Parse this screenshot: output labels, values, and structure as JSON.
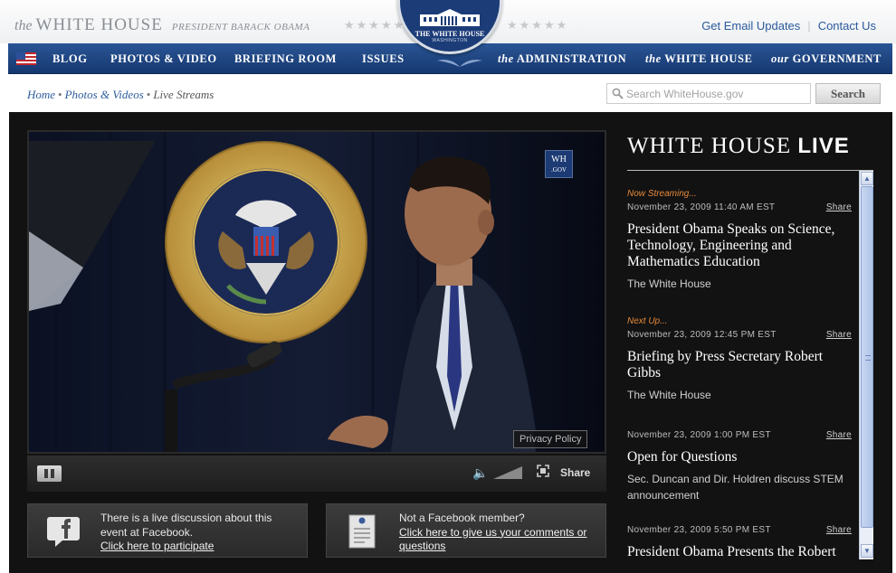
{
  "header": {
    "site_prefix": "the",
    "site_name": "WHITE HOUSE",
    "site_subtitle": "PRESIDENT BARACK OBAMA",
    "seal_line1": "THE WHITE HOUSE",
    "seal_line2": "WASHINGTON",
    "links": {
      "email": "Get Email Updates",
      "contact": "Contact Us"
    }
  },
  "nav": {
    "blog": "BLOG",
    "photos": "PHOTOS & VIDEO",
    "briefing": "BRIEFING ROOM",
    "issues": "ISSUES",
    "admin_prefix": "the",
    "admin": "ADMINISTRATION",
    "wh_prefix": "the",
    "wh": "WHITE HOUSE",
    "gov_prefix": "our",
    "gov": "GOVERNMENT"
  },
  "breadcrumb": {
    "home": "Home",
    "photos": "Photos & Videos",
    "current": "Live Streams",
    "sep": "•"
  },
  "search": {
    "placeholder": "Search WhiteHouse.gov",
    "button": "Search"
  },
  "video": {
    "logo_line1": "WH",
    "logo_line2": ".GOV",
    "privacy": "Privacy Policy",
    "share": "Share"
  },
  "facebook": {
    "left_text": "There is a live discussion about this event at Facebook.",
    "left_link": "Click here to participate",
    "right_text": "Not a Facebook member?",
    "right_link": "Click here to give us your comments or questions"
  },
  "live": {
    "title_main": "WHITE HOUSE",
    "title_bold": "LIVE",
    "share_label": "Share",
    "events": [
      {
        "status": "Now Streaming...",
        "date": "November 23, 2009 11:40 AM EST",
        "title": "President Obama Speaks on Science, Technology, Engineering and Mathematics Education",
        "source": "The White House"
      },
      {
        "status": "Next Up...",
        "date": "November 23, 2009 12:45 PM EST",
        "title": "Briefing by Press Secretary Robert Gibbs",
        "source": "The White House"
      },
      {
        "status": "",
        "date": "November 23, 2009 1:00 PM EST",
        "title": "Open for Questions",
        "source": "Sec. Duncan and Dir. Holdren discuss STEM announcement"
      },
      {
        "status": "",
        "date": "November 23, 2009 5:50 PM EST",
        "title": "President Obama Presents the Robert",
        "source": ""
      }
    ]
  },
  "colors": {
    "nav_blue": "#1f4785",
    "link_blue": "#2a5a9c",
    "status_orange": "#e88a3a",
    "stage_bg": "#121212"
  }
}
